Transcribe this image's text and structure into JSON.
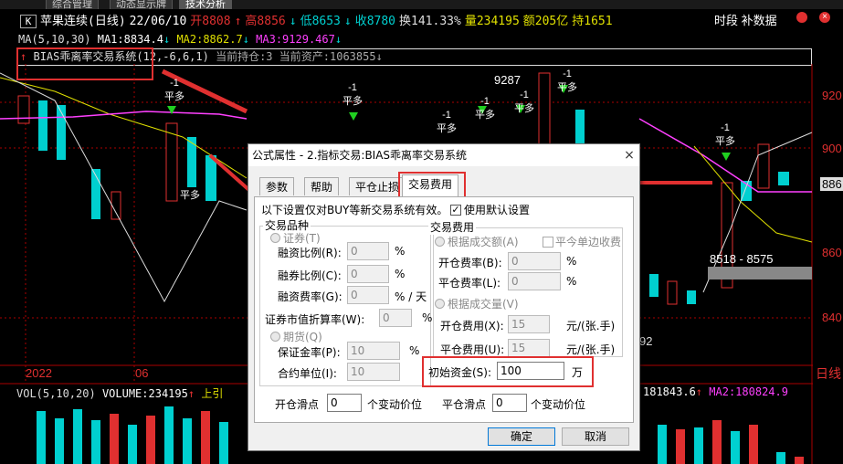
{
  "top_tabs": [
    "综合管理",
    "动态显示牌",
    "技术分析"
  ],
  "header": {
    "k_icon": "K",
    "stock": "苹果连续(日线)",
    "date": "22/06/10",
    "open": "开8808",
    "high": "高8856",
    "low": "低8653",
    "close": "收8780",
    "turnover": "换141.33%",
    "volume": "量234195",
    "amount": "额205亿",
    "hold": "持1651",
    "menu1": "时段",
    "menu2": "补数据"
  },
  "ma_line": {
    "label": "MA(5,10,30)",
    "ma1": "MA1:8834.4",
    "ma2": "MA2:8862.7",
    "ma3": "MA3:9129.467"
  },
  "bias_line": {
    "name": "BIAS乖离率交易系统(12,-6,6,1)",
    "position": "当前持仓:3",
    "assets": "当前资产:1063855"
  },
  "chart_labels": {
    "peak": "9287",
    "range_low": "8518",
    "range_dash": "-",
    "range_high": "8575",
    "partial": "92",
    "signal_minus": "-1",
    "signal_ping": "平多",
    "year": "2022",
    "month": "06",
    "day_tab": "日线"
  },
  "price_ticks": [
    "920",
    "900",
    "886",
    "860",
    "840"
  ],
  "volume_line": {
    "label": "VOL(5,10,20)",
    "volume": "VOLUME:234195",
    "arrow": "上引",
    "ma1": "181843.6",
    "ma2": "MA2:180824.9"
  },
  "dialog": {
    "title": "公式属性 - 2.指标交易:BIAS乖离率交易系统",
    "close": "×",
    "tabs": [
      "参数",
      "帮助",
      "平仓止损",
      "交易费用"
    ],
    "note": "以下设置仅对BUY等新交易系统有效。",
    "use_default": "使用默认设置",
    "group_type": "交易品种",
    "opt_security": "证券(T)",
    "margin_ratio": "融资比例(R):",
    "secu_ratio": "融券比例(C):",
    "fin_rate": "融资费率(G):",
    "val_convert": "证券市值折算率(W):",
    "opt_futures": "期货(Q)",
    "deposit_rate": "保证金率(P):",
    "contract_unit": "合约单位(I):",
    "group_fee": "交易费用",
    "opt_by_amount": "根据成交额(A)",
    "close_today": "平今单边收费",
    "open_fee_rate": "开仓费率(B):",
    "close_fee_rate": "平仓费率(L):",
    "opt_by_volume": "根据成交量(V)",
    "open_fee": "开仓费用(X):",
    "close_fee": "平仓费用(U):",
    "per_hand": "元/(张.手)",
    "init_funds": "初始资金(S):",
    "init_funds_value": "100",
    "wan": "万",
    "open_slip": "开仓滑点",
    "close_slip": "平仓滑点",
    "slip_unit": "个变动价位",
    "open_slip_value": "0",
    "close_slip_value": "0",
    "ok": "确定",
    "cancel": "取消",
    "pct": "%",
    "pct_day": "% / 天",
    "zero": "0",
    "fifteen": "15",
    "ten": "10"
  },
  "colors": {
    "up": "#e03030",
    "down": "#00d0d0",
    "ma1": "#ffffff",
    "ma2": "#e0e000",
    "ma3": "#ff40ff",
    "highlight": "#e03030"
  }
}
